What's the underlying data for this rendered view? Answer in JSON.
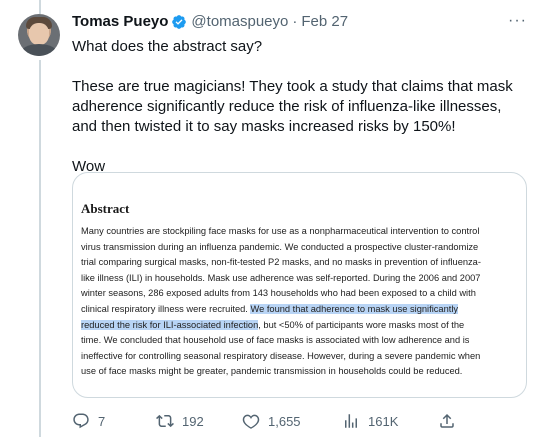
{
  "tweet": {
    "author_name": "Tomas Pueyo",
    "handle": "@tomaspueyo",
    "separator": "·",
    "date": "Feb 27",
    "more_label": "···",
    "paragraphs": [
      "What does the abstract say?",
      "These are true magicians! They took a study that claims that mask adherence significantly reduce the risk of influenza-like illnesses, and then twisted it to say masks increased risks by 150%!",
      "Wow"
    ]
  },
  "media": {
    "abstract_title": "Abstract",
    "lines": [
      {
        "text": "Many countries are stockpiling face masks for use as a nonpharmaceutical intervention to control"
      },
      {
        "text": "virus transmission during an influenza pandemic. We conducted a prospective cluster-randomize"
      },
      {
        "text": "trial comparing surgical masks, non-fit-tested P2 masks, and no masks in prevention of influenza-"
      },
      {
        "text": "like illness (ILI) in households. Mask use adherence was self-reported. During the 2006 and 2007"
      },
      {
        "text": "winter seasons, 286 exposed adults from 143 households who had been exposed to a child with"
      },
      {
        "pre": "clinical respiratory illness were recruited. ",
        "highlight": "We found that adherence to mask use significantly",
        "post": ""
      },
      {
        "pre": "",
        "highlight": "reduced the risk for ILI-associated infection",
        "post": ", but <50% of participants wore masks most of the"
      },
      {
        "text": "time. We concluded that household use of face masks is associated with low adherence and is"
      },
      {
        "text": "ineffective for controlling seasonal respiratory disease. However, during a severe pandemic when"
      },
      {
        "text": "use of face masks might be greater, pandemic transmission in households could be reduced."
      }
    ]
  },
  "actions": {
    "replies": "7",
    "retweets": "192",
    "likes": "1,655",
    "views": "161K"
  },
  "icons": {
    "verified": "verified-badge-icon",
    "reply": "reply-icon",
    "retweet": "retweet-icon",
    "like": "heart-icon",
    "views": "views-icon",
    "share": "share-icon"
  },
  "colors": {
    "verified_blue": "#1d9bf0",
    "secondary_text": "#536471",
    "highlight": "#b8d4f5"
  }
}
